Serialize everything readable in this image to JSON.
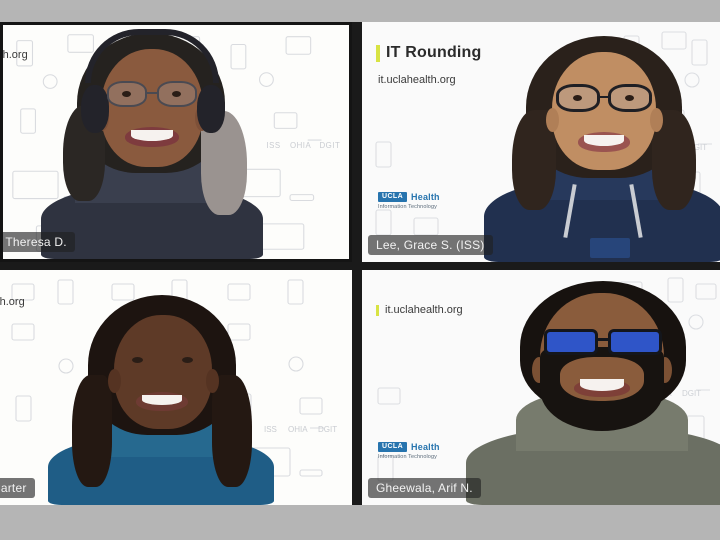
{
  "app": {
    "kind": "video-conference-grid",
    "layout": "2x2",
    "stage_background": "#b5b5b5"
  },
  "branding": {
    "title": "IT Rounding",
    "url": "it.uclahealth.org",
    "url_clipped": "alth.org",
    "accent_color": "#d8e343",
    "logo": {
      "mark": "UCLA",
      "word": "Health",
      "sub": "Information Technology",
      "mark_color": "#2774ae"
    }
  },
  "tiles": [
    {
      "id": "tile-top-left",
      "position": "top-left",
      "speaking": false,
      "name_label": "r, Theresa D.",
      "name_label_clipped": true,
      "background_url_text": "alth.org",
      "shows_title": false,
      "shows_logo": false,
      "participant": {
        "display_name": "r, Theresa D.",
        "wearing": [
          "headset",
          "eyeglasses"
        ],
        "attire_color": "#2f3340"
      }
    },
    {
      "id": "tile-top-right",
      "position": "top-right",
      "speaking": true,
      "name_label": "Lee, Grace S. (ISS)",
      "name_label_clipped": false,
      "background_url_text": "it.uclahealth.org",
      "shows_title": true,
      "shows_logo": true,
      "participant": {
        "display_name": "Lee, Grace S. (ISS)",
        "wearing": [
          "eyeglasses",
          "lanyard-badge"
        ],
        "attire_color": "#21304f"
      }
    },
    {
      "id": "tile-bottom-left",
      "position": "bottom-left",
      "speaking": false,
      "name_label": "Carter",
      "name_label_clipped": true,
      "background_url_text": "alth.org",
      "shows_title": false,
      "shows_logo": false,
      "participant": {
        "display_name": "Carter",
        "wearing": [],
        "attire_color": "#1f5d86"
      }
    },
    {
      "id": "tile-bottom-right",
      "position": "bottom-right",
      "speaking": false,
      "name_label": "Gheewala, Arif N.",
      "name_label_clipped": false,
      "background_url_text": "it.uclahealth.org",
      "shows_title": false,
      "shows_logo": true,
      "participant": {
        "display_name": "Gheewala, Arif N.",
        "wearing": [
          "eyeglasses",
          "beard"
        ],
        "attire_color": "#6b6f63"
      }
    }
  ],
  "background_pattern": {
    "description": "faint line-art technology device icons",
    "labels": [
      "ISS",
      "OHIA",
      "DGIT"
    ],
    "line_color": "#d7d9dd"
  }
}
